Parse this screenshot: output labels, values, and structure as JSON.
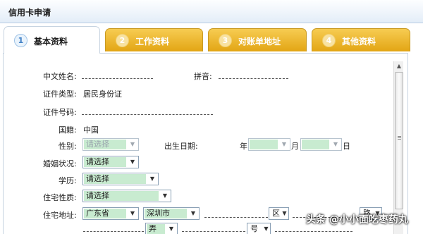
{
  "window": {
    "title": "信用卡申请"
  },
  "tabs": [
    {
      "num": "1",
      "label": "基本资料",
      "active": true
    },
    {
      "num": "2",
      "label": "工作资料",
      "active": false
    },
    {
      "num": "3",
      "label": "对账单地址",
      "active": false
    },
    {
      "num": "4",
      "label": "其他资料",
      "active": false
    }
  ],
  "form": {
    "chinese_name_label": "中文姓名:",
    "pinyin_label": "拼音:",
    "id_type_label": "证件类型:",
    "id_type_value": "居民身份证",
    "id_number_label": "证件号码:",
    "nationality_label": "国籍:",
    "nationality_value": "中国",
    "gender_label": "性别:",
    "gender_placeholder": "请选择",
    "birthdate_label": "出生日期:",
    "birth_year_unit": "年",
    "birth_month_unit": "月",
    "birth_day_unit": "日",
    "marital_label": "婚姻状况:",
    "marital_value": "请选择",
    "education_label": "学历:",
    "education_value": "请选择",
    "housing_label": "住宅性质:",
    "housing_value": "请选择",
    "address_label": "住宅地址:",
    "province_value": "广东省",
    "city_value": "深圳市",
    "district_unit": "区",
    "road_unit": "路",
    "lane_value": "弄",
    "number_unit": "号"
  },
  "watermark": "头条 @小小面吃枣药丸"
}
